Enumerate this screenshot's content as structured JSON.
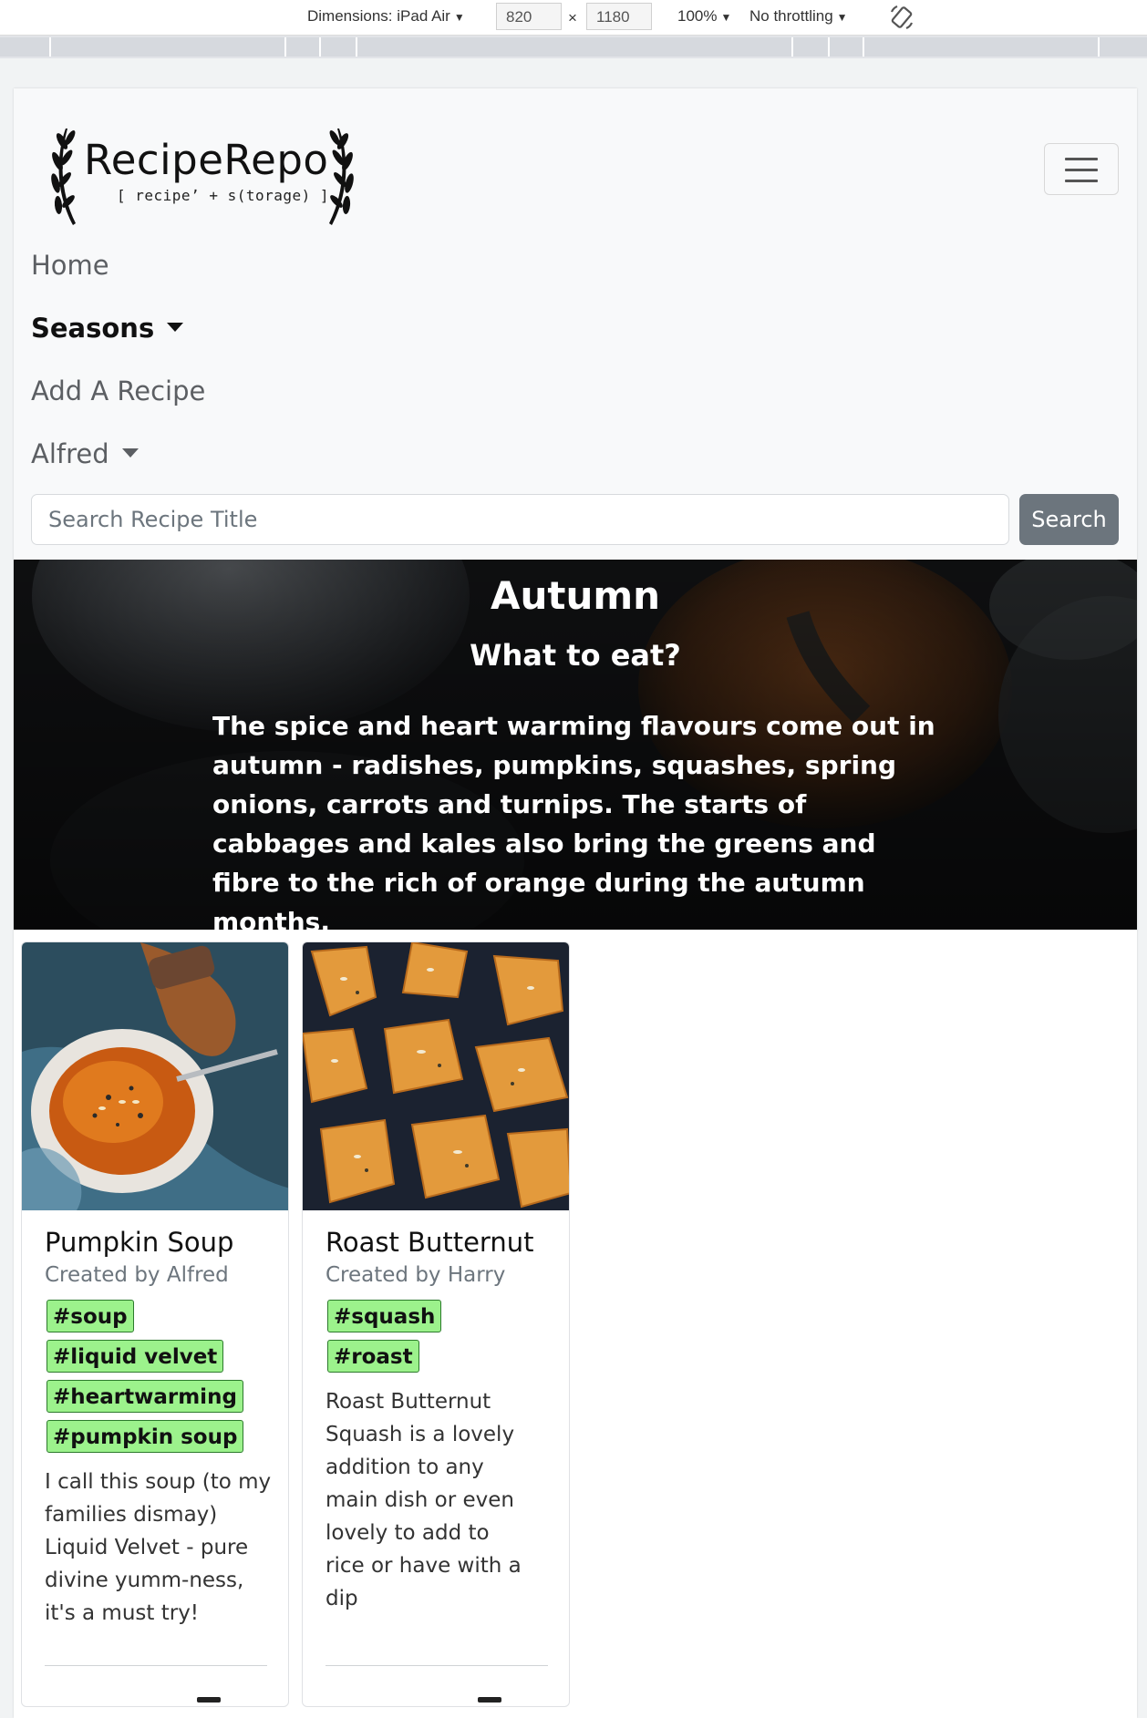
{
  "devtools": {
    "dimensions_label": "Dimensions: iPad Air",
    "width_value": "820",
    "times": "×",
    "height_value": "1180",
    "zoom": "100%",
    "throttling": "No throttling",
    "rotate_icon": "rotate-icon"
  },
  "brand": {
    "title": "RecipeRepo",
    "subtitle": "[ recipeʼ + s(torage) ]",
    "logo_icon": "laurel-wreath-icon"
  },
  "nav": {
    "toggler_icon": "hamburger-menu-icon",
    "items": [
      {
        "label": "Home",
        "active": false,
        "dropdown": false
      },
      {
        "label": "Seasons",
        "active": true,
        "dropdown": true
      },
      {
        "label": "Add A Recipe",
        "active": false,
        "dropdown": false
      },
      {
        "label": "Alfred",
        "active": false,
        "dropdown": true
      }
    ]
  },
  "search": {
    "placeholder": "Search Recipe Title",
    "button_label": "Search"
  },
  "hero": {
    "title": "Autumn",
    "subtitle": "What to eat?",
    "text": "The spice and heart warming flavours come out in autumn - radishes, pumpkins, squashes, spring onions, carrots and turnips. The starts of cabbages and kales also bring the greens and fibre to the rich of orange during the autumn months."
  },
  "recipes": [
    {
      "title": "Pumpkin Soup",
      "author": "Created by Alfred",
      "tags": [
        "#soup",
        "#liquid velvet",
        "#heartwarming",
        "#pumpkin soup"
      ],
      "description": "I call this soup (to my families dismay) Liquid Velvet - pure divine yumm-ness, it's a must try!"
    },
    {
      "title": "Roast Butternut",
      "author": "Created by Harry",
      "tags": [
        "#squash",
        "#roast"
      ],
      "description": "Roast Butternut Squash is a lovely addition to any main dish or even lovely to add to rice or have with a dip"
    }
  ],
  "colors": {
    "tag_bg": "#9cf28c",
    "search_btn": "#6c757d",
    "navbar_bg": "#f8f9fa"
  }
}
